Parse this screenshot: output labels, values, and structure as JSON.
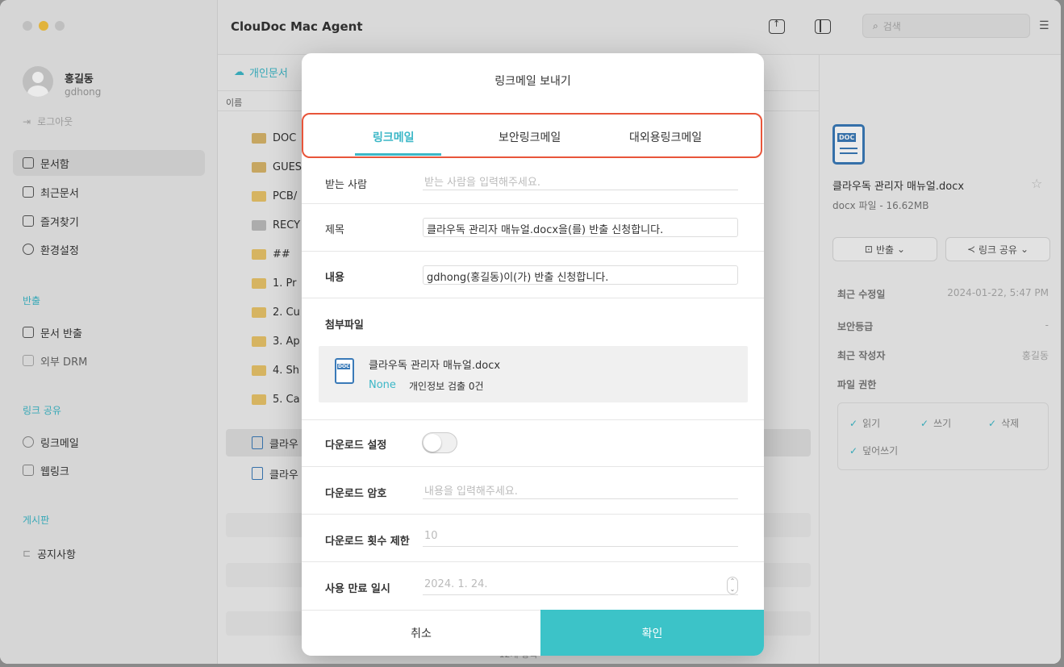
{
  "window": {
    "app_title": "ClouDoc Mac Agent"
  },
  "user": {
    "name": "홍길동",
    "id": "gdhong",
    "logout": "로그아웃"
  },
  "sidebar": {
    "main_items": [
      {
        "label": "문서함",
        "icon": "inbox-icon"
      },
      {
        "label": "최근문서",
        "icon": "recent-docs-icon"
      },
      {
        "label": "즐겨찾기",
        "icon": "favorites-icon"
      },
      {
        "label": "환경설정",
        "icon": "settings-icon"
      }
    ],
    "section_export": "반출",
    "export_items": [
      {
        "label": "문서 반출",
        "icon": "export-doc-icon"
      },
      {
        "label": "외부 DRM",
        "icon": "external-drm-icon"
      }
    ],
    "section_share": "링크 공유",
    "share_items": [
      {
        "label": "링크메일",
        "icon": "link-mail-icon"
      },
      {
        "label": "웹링크",
        "icon": "web-link-icon"
      }
    ],
    "section_board": "게시판",
    "board_items": [
      {
        "label": "공지사항",
        "icon": "megaphone-icon"
      }
    ]
  },
  "toolbar": {
    "search_placeholder": "검색"
  },
  "filelist": {
    "breadcrumb": "개인문서",
    "column_name": "이름",
    "rows": [
      "DOC",
      "GUES",
      "PCB/",
      "RECY",
      "##",
      "1. Pr",
      "2. Cu",
      "3. Ap",
      "4. Sh",
      "5. Ca",
      "클라우",
      "클라우"
    ],
    "count": "12개 항목"
  },
  "detail": {
    "file_name": "클라우독 관리자 매뉴얼.docx",
    "file_sub": "docx 파일 - 16.62MB",
    "export_btn": "반출",
    "share_btn": "링크 공유",
    "modified_label": "최근 수정일",
    "modified_value": "2024-01-22, 5:47 PM",
    "security_label": "보안등급",
    "security_value": "-",
    "author_label": "최근 작성자",
    "author_value": "홍길동",
    "perm_label": "파일 권한",
    "perms": [
      "읽기",
      "쓰기",
      "삭제",
      "덮어쓰기"
    ]
  },
  "modal": {
    "title": "링크메일 보내기",
    "tabs": [
      "링크메일",
      "보안링크메일",
      "대외용링크메일"
    ],
    "recipient_label": "받는 사람",
    "recipient_placeholder": "받는 사람을 입력해주세요.",
    "subject_label": "제목",
    "subject_value": "클라우독 관리자 매뉴얼.docx을(를) 반출 신청합니다.",
    "content_label": "내용",
    "content_value": "gdhong(홍길동)이(가) 반출 신청합니다.",
    "attach_label": "첨부파일",
    "attach_name": "클라우독 관리자 매뉴얼.docx",
    "attach_status": "None",
    "attach_info": "개인정보 검출 0건",
    "download_setting_label": "다운로드 설정",
    "download_password_label": "다운로드 암호",
    "download_password_placeholder": "내용을 입력해주세요.",
    "download_limit_label": "다운로드 횟수 제한",
    "download_limit_value": "10",
    "expire_label": "사용 만료 일시",
    "expire_value": "2024.  1. 24.",
    "cancel": "취소",
    "confirm": "확인"
  },
  "colors": {
    "accent": "#3cb7c7",
    "highlight_border": "#e8553a",
    "confirm_bg": "#3cc3c8"
  }
}
